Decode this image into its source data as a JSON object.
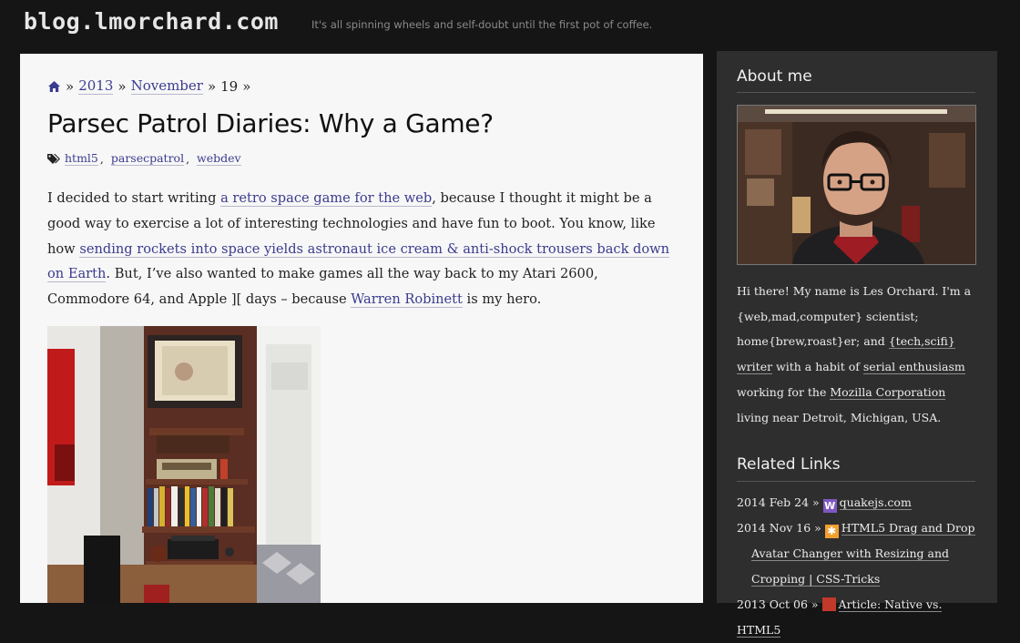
{
  "header": {
    "site_title": "blog.lmorchard.com",
    "tagline": "It's all spinning wheels and self-doubt until the first pot of coffee."
  },
  "breadcrumb": {
    "home_icon": "home-icon",
    "sep": "»",
    "year": "2013",
    "month": "November",
    "day": "19"
  },
  "post": {
    "title": "Parsec Patrol Diaries: Why a Game?",
    "tags_icon": "tags-icon",
    "tags": [
      "html5",
      "parsecpatrol",
      "webdev"
    ],
    "p1_a": "I decided to start writing ",
    "p1_link1": "a retro space game for the web",
    "p1_b": ", because I thought it might be a good way to exercise a lot of interesting technologies and have fun to boot. You know, like how ",
    "p1_link2": "sending rockets into space yields astronaut ice cream & anti-shock trousers back down on Earth",
    "p1_c": ". But, I’ve also wanted to make games all the way back to my Atari 2600, Commodore 64, and Apple ][ days – because ",
    "p1_link3": "Warren Robinett",
    "p1_d": " is my hero."
  },
  "sidebar": {
    "about_title": "About me",
    "bio_a": "Hi there! My name is Les Orchard. I'm a {web,mad,computer} scientist; home{brew,roast}er; and ",
    "bio_link1": "{tech,scifi} writer",
    "bio_b": " with a habit of ",
    "bio_link2": "serial enthusiasm",
    "bio_c": " working for the ",
    "bio_link3": "Mozilla Corporation",
    "bio_d": " living near Detroit, Michigan, USA.",
    "related_title": "Related Links",
    "related": [
      {
        "date": "2014 Feb 24 »",
        "icon": "w-favicon-icon",
        "icon_text": "W",
        "title": "quakejs.com"
      },
      {
        "date": "2014 Nov 16 »",
        "icon": "star-favicon-icon",
        "icon_text": "✱",
        "title": "HTML5 Drag and Drop",
        "title_cont": "Avatar Changer with Resizing and Cropping | CSS-Tricks"
      },
      {
        "date": "2013 Oct 06 »",
        "icon": "red-favicon-icon",
        "icon_text": "",
        "title": "Article: Native vs. HTML5"
      }
    ]
  },
  "colors": {
    "page_bg": "#151515",
    "main_bg": "#f7f7f7",
    "sidebar_bg": "#2e2e2e",
    "link": "#3b3b8f"
  }
}
